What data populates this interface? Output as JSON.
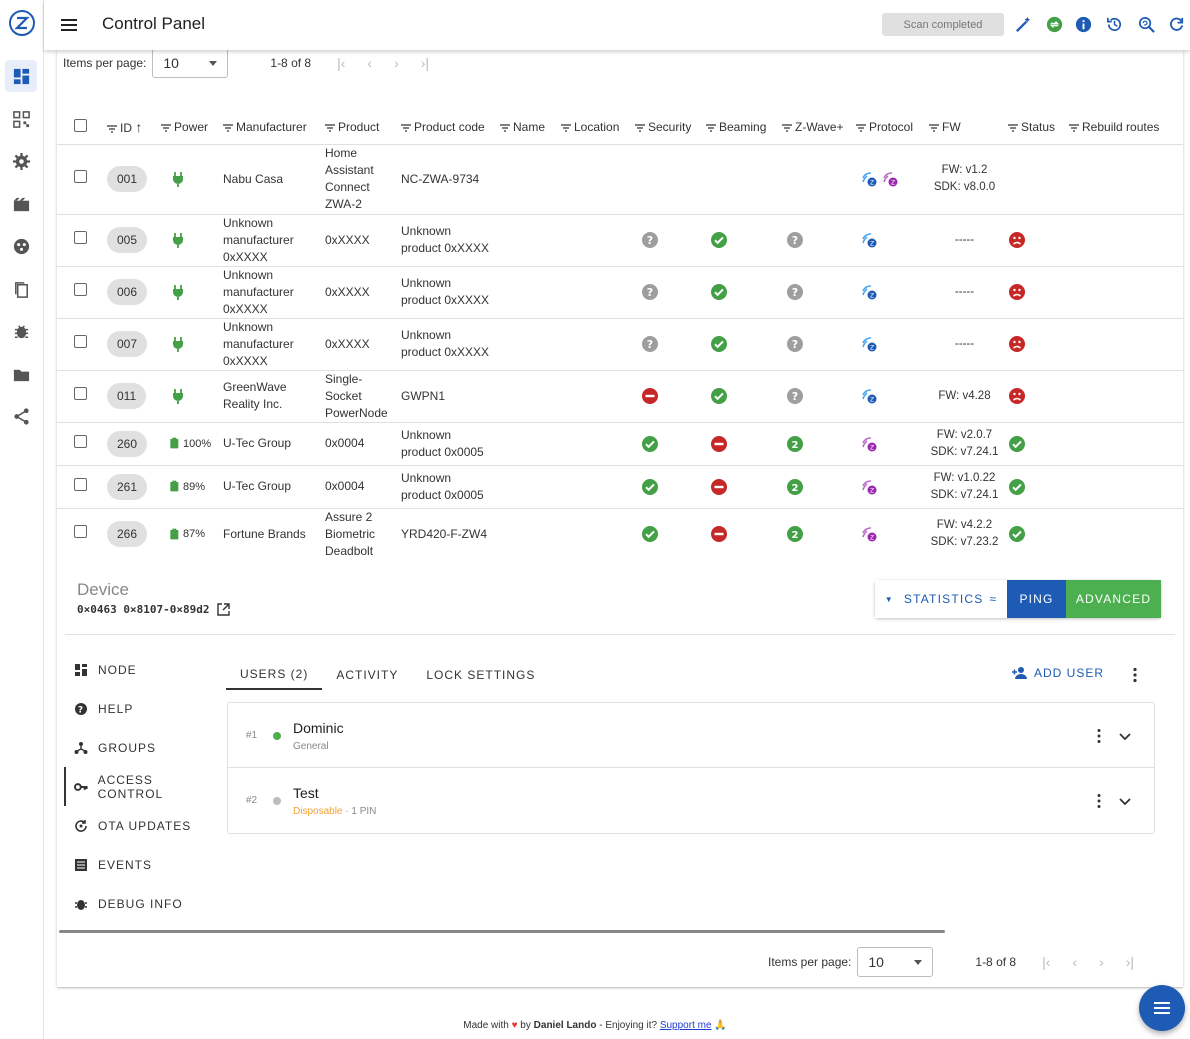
{
  "app": {
    "title": "Control Panel",
    "scan_status": "Scan completed"
  },
  "pager_top": {
    "items_label": "Items per page:",
    "items_value": "10",
    "range": "1-8 of 8"
  },
  "pager_bottom": {
    "items_label": "Items per page:",
    "items_value": "10",
    "range": "1-8 of 8"
  },
  "columns": [
    "ID",
    "Power",
    "Manufacturer",
    "Product",
    "Product code",
    "Name",
    "Location",
    "Security",
    "Beaming",
    "Z-Wave+",
    "Protocol",
    "FW",
    "Status",
    "Rebuild routes"
  ],
  "rows": [
    {
      "id": "001",
      "power": "plug",
      "battery": "",
      "manufacturer": "Nabu Casa",
      "product": "Home Assistant Connect ZWA-2",
      "code": "NC-ZWA-9734",
      "security": "",
      "beaming": "",
      "zwplus": "",
      "protocol": [
        "zw-blue",
        "zw-purple"
      ],
      "fw": "FW: v1.2\nSDK: v8.0.0",
      "status": ""
    },
    {
      "id": "005",
      "power": "plug",
      "battery": "",
      "manufacturer": "Unknown manufacturer 0xXXXX",
      "product": "0xXXXX",
      "code": "Unknown product 0xXXXX",
      "security": "unknown",
      "beaming": "yes",
      "zwplus": "unknown",
      "protocol": [
        "zw-blue"
      ],
      "fw": "-----",
      "status": "dead"
    },
    {
      "id": "006",
      "power": "plug",
      "battery": "",
      "manufacturer": "Unknown manufacturer 0xXXXX",
      "product": "0xXXXX",
      "code": "Unknown product 0xXXXX",
      "security": "unknown",
      "beaming": "yes",
      "zwplus": "unknown",
      "protocol": [
        "zw-blue"
      ],
      "fw": "-----",
      "status": "dead"
    },
    {
      "id": "007",
      "power": "plug",
      "battery": "",
      "manufacturer": "Unknown manufacturer 0xXXXX",
      "product": "0xXXXX",
      "code": "Unknown product 0xXXXX",
      "security": "unknown",
      "beaming": "yes",
      "zwplus": "unknown",
      "protocol": [
        "zw-blue"
      ],
      "fw": "-----",
      "status": "dead"
    },
    {
      "id": "011",
      "power": "plug",
      "battery": "",
      "manufacturer": "GreenWave Reality Inc.",
      "product": "Single-Socket PowerNode",
      "code": "GWPN1",
      "security": "no",
      "beaming": "yes",
      "zwplus": "unknown",
      "protocol": [
        "zw-blue"
      ],
      "fw": "FW: v4.28",
      "status": "dead"
    },
    {
      "id": "260",
      "power": "battery",
      "battery": "100%",
      "manufacturer": "U-Tec Group",
      "product": "0x0004",
      "code": "Unknown product 0x0005",
      "security": "yes",
      "beaming": "no",
      "zwplus": "v2",
      "protocol": [
        "zw-purple"
      ],
      "fw": "FW: v2.0.7\nSDK: v7.24.1",
      "status": "alive"
    },
    {
      "id": "261",
      "power": "battery",
      "battery": "89%",
      "manufacturer": "U-Tec Group",
      "product": "0x0004",
      "code": "Unknown product 0x0005",
      "security": "yes",
      "beaming": "no",
      "zwplus": "v2",
      "protocol": [
        "zw-purple"
      ],
      "fw": "FW: v1.0.22\nSDK: v7.24.1",
      "status": "alive"
    },
    {
      "id": "266",
      "power": "battery",
      "battery": "87%",
      "manufacturer": "Fortune Brands",
      "product": "Assure 2 Biometric Deadbolt",
      "code": "YRD420-F-ZW4",
      "security": "yes",
      "beaming": "no",
      "zwplus": "v2",
      "protocol": [
        "zw-purple"
      ],
      "fw": "FW: v4.2.2\nSDK: v7.23.2",
      "status": "alive"
    }
  ],
  "device": {
    "label": "Device",
    "address": "0×0463 0×8107-0×89d2"
  },
  "device_buttons": {
    "statistics": "STATISTICS",
    "ping": "PING",
    "advanced": "ADVANCED"
  },
  "side_nav": [
    {
      "label": "NODE",
      "icon": "grid-icon"
    },
    {
      "label": "HELP",
      "icon": "help-icon"
    },
    {
      "label": "GROUPS",
      "icon": "groups-icon"
    },
    {
      "label": "ACCESS CONTROL",
      "icon": "key-icon"
    },
    {
      "label": "OTA UPDATES",
      "icon": "update-icon"
    },
    {
      "label": "EVENTS",
      "icon": "events-icon"
    },
    {
      "label": "DEBUG INFO",
      "icon": "bug-icon"
    }
  ],
  "tabs": [
    "USERS (2)",
    "ACTIVITY",
    "LOCK SETTINGS"
  ],
  "add_user": "ADD USER",
  "users": [
    {
      "num": "#1",
      "name": "Dominic",
      "sub": "General",
      "sub2": "",
      "dot": "#4caf50"
    },
    {
      "num": "#2",
      "name": "Test",
      "sub": "Disposable",
      "sub2": " · 1 PIN",
      "dot": "#bdbdbd"
    }
  ],
  "footer": {
    "made": "Made with",
    "by": " by ",
    "author": "Daniel Lando",
    "enjoy": " - Enjoying it? ",
    "support": "Support me"
  },
  "colors": {
    "accent": "#1e5bb5",
    "success": "#43a047",
    "error": "#c62828",
    "battery": "#43a047"
  }
}
